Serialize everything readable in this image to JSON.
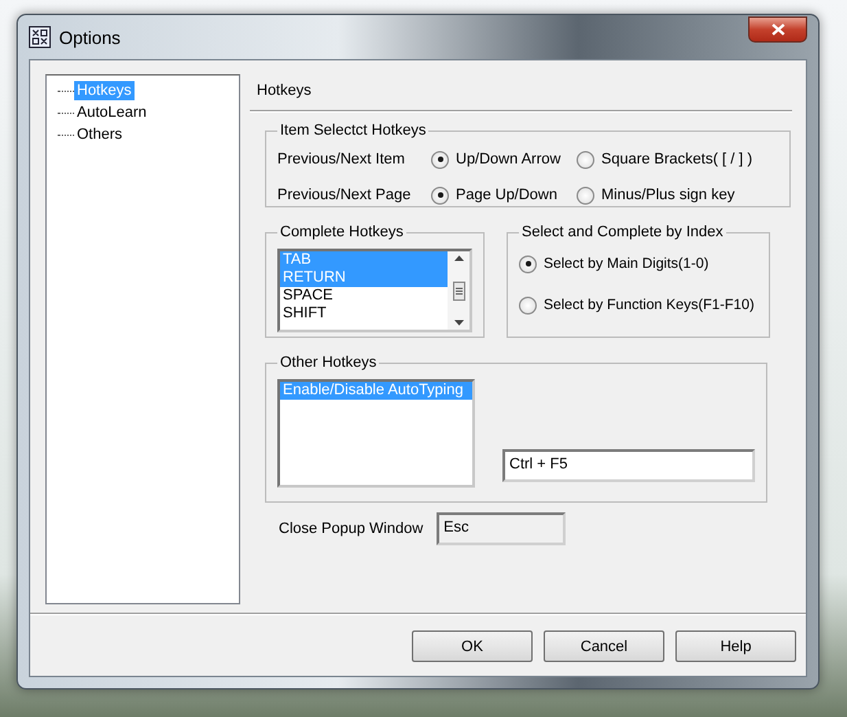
{
  "window": {
    "title": "Options"
  },
  "tree": [
    {
      "label": "Hotkeys",
      "selected": true
    },
    {
      "label": "AutoLearn",
      "selected": false
    },
    {
      "label": "Others",
      "selected": false
    }
  ],
  "page_title": "Hotkeys",
  "item_select_hotkeys": {
    "title": "Item Selectct Hotkeys",
    "rows": [
      {
        "label": "Previous/Next Item",
        "options": [
          {
            "label": "Up/Down Arrow",
            "selected": true
          },
          {
            "label": "Square Brackets( [ / ] )",
            "selected": false
          }
        ]
      },
      {
        "label": "Previous/Next Page",
        "options": [
          {
            "label": "Page Up/Down",
            "selected": true
          },
          {
            "label": "Minus/Plus sign key",
            "selected": false
          }
        ]
      }
    ]
  },
  "complete_hotkeys": {
    "title": "Complete Hotkeys",
    "items": [
      {
        "label": "TAB",
        "selected": true
      },
      {
        "label": "RETURN",
        "selected": true
      },
      {
        "label": "SPACE",
        "selected": false
      },
      {
        "label": "SHIFT",
        "selected": false
      }
    ]
  },
  "select_by_index": {
    "title": "Select and Complete by Index",
    "options": [
      {
        "label": "Select by Main Digits(1-0)",
        "selected": true
      },
      {
        "label": "Select by Function Keys(F1-F10)",
        "selected": false
      }
    ]
  },
  "other_hotkeys": {
    "title": "Other Hotkeys",
    "items": [
      {
        "label": "Enable/Disable AutoTyping",
        "selected": true
      }
    ],
    "value": "Ctrl + F5"
  },
  "close_popup": {
    "label": "Close Popup Window",
    "value": "Esc"
  },
  "buttons": [
    "OK",
    "Cancel",
    "Help"
  ]
}
